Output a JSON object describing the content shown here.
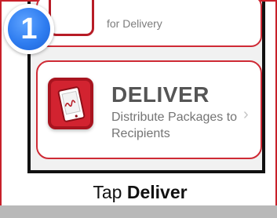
{
  "step": {
    "number": "1"
  },
  "app": {
    "previous_item": {
      "label": "for Delivery"
    },
    "deliver_item": {
      "icon": "tablet-signature-icon",
      "title": "DELIVER",
      "subtitle": "Distribute Packages to Recipients",
      "chevron": "›"
    }
  },
  "caption": {
    "prefix": "Tap ",
    "emphasis": "Deliver"
  },
  "colors": {
    "accent": "#cf2a35",
    "badge": "#2f7df0",
    "icon_fill": "#d22330"
  }
}
